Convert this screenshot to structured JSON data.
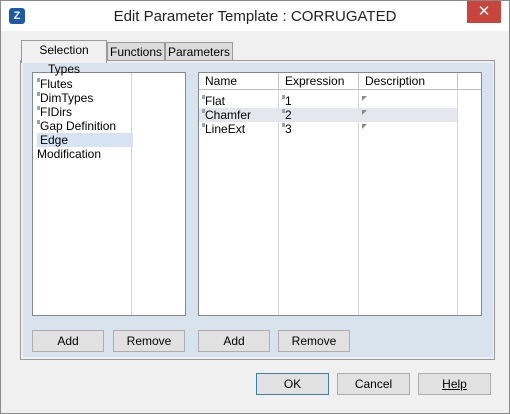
{
  "window": {
    "title": "Edit Parameter Template : CORRUGATED",
    "app_icon": "Z",
    "close_glyph": "✕"
  },
  "tabs": [
    {
      "label": "Selection Types",
      "active": true
    },
    {
      "label": "Functions",
      "active": false
    },
    {
      "label": "Parameters",
      "active": false
    }
  ],
  "selection_types": {
    "items": [
      "Flutes",
      "DimTypes",
      "FIDirs",
      "Gap Definition",
      "Edge Modification"
    ],
    "selected_index": 4,
    "add_label": "Add",
    "remove_label": "Remove"
  },
  "parameters_grid": {
    "columns": [
      "Name",
      "Expression",
      "Description"
    ],
    "rows": [
      {
        "name": "Flat",
        "expression": "1",
        "description": ""
      },
      {
        "name": "Chamfer",
        "expression": "2",
        "description": ""
      },
      {
        "name": "LineExt",
        "expression": "3",
        "description": ""
      }
    ],
    "add_label": "Add",
    "remove_label": "Remove"
  },
  "dialog_buttons": {
    "ok": "OK",
    "cancel": "Cancel",
    "help": "Help"
  }
}
